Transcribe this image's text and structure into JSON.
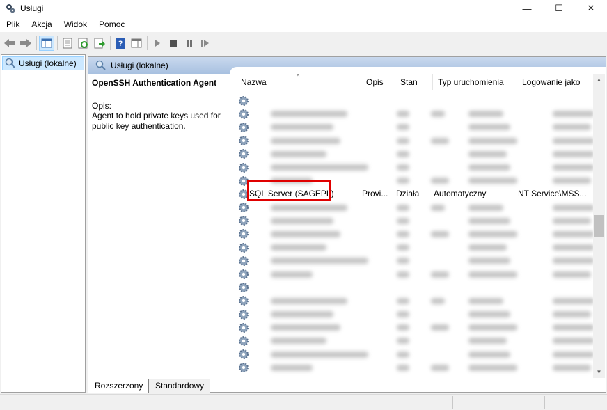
{
  "window": {
    "title": "Usługi",
    "app_icon": "gear-services-icon",
    "controls": {
      "minimize": "—",
      "maximize": "☐",
      "close": "✕"
    }
  },
  "menu": [
    "Plik",
    "Akcja",
    "Widok",
    "Pomoc"
  ],
  "toolbar": [
    "back-arrow-icon",
    "forward-arrow-icon",
    "console-tree-icon",
    "properties-icon",
    "refresh-icon",
    "export-icon",
    "help-icon",
    "show-hide-icon",
    "start-icon",
    "stop-icon",
    "pause-icon",
    "resume-icon"
  ],
  "left_tree": {
    "item": "Usługi (lokalne)"
  },
  "right_header": "Usługi (lokalne)",
  "details": {
    "service_name": "OpenSSH Authentication Agent",
    "description_label": "Opis:",
    "description_text": "Agent to hold private keys used for public key authentication."
  },
  "columns": [
    "Nazwa",
    "Opis",
    "Stan",
    "Typ uruchomienia",
    "Logowanie jako"
  ],
  "selected_row": {
    "name": "SQL Server (SAGEPL)",
    "desc": "Provi...",
    "state": "Działa",
    "startup": "Automatyczny",
    "logon": "NT Service\\MSS..."
  },
  "tabs": [
    "Rozszerzony",
    "Standardowy"
  ],
  "colors": {
    "highlight": "#e00000",
    "header_grad": "#b9cee8"
  }
}
